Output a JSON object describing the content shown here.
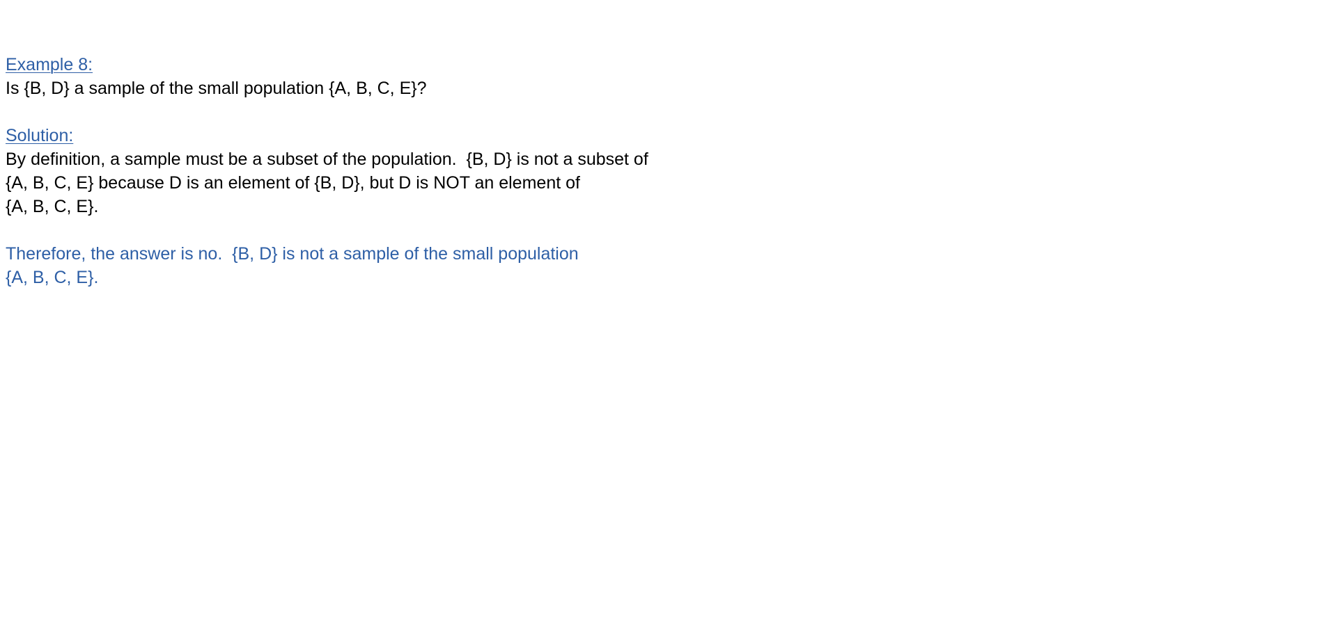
{
  "example": {
    "heading": "Example 8:",
    "question": "Is {B, D} a sample of the small population {A, B, C, E}?"
  },
  "solution": {
    "heading": "Solution:",
    "body_lines": [
      "By definition, a sample must be a subset of the population.  {B, D} is not a subset of",
      "{A, B, C, E} because D is an element of {B, D}, but D is NOT an element of",
      "{A, B, C, E}."
    ],
    "conclusion_lines": [
      "Therefore, the answer is no.  {B, D} is not a sample of the small population",
      "{A, B, C, E}."
    ]
  },
  "colors": {
    "accent": "#2e5fa6",
    "text": "#000000",
    "background": "#ffffff"
  }
}
